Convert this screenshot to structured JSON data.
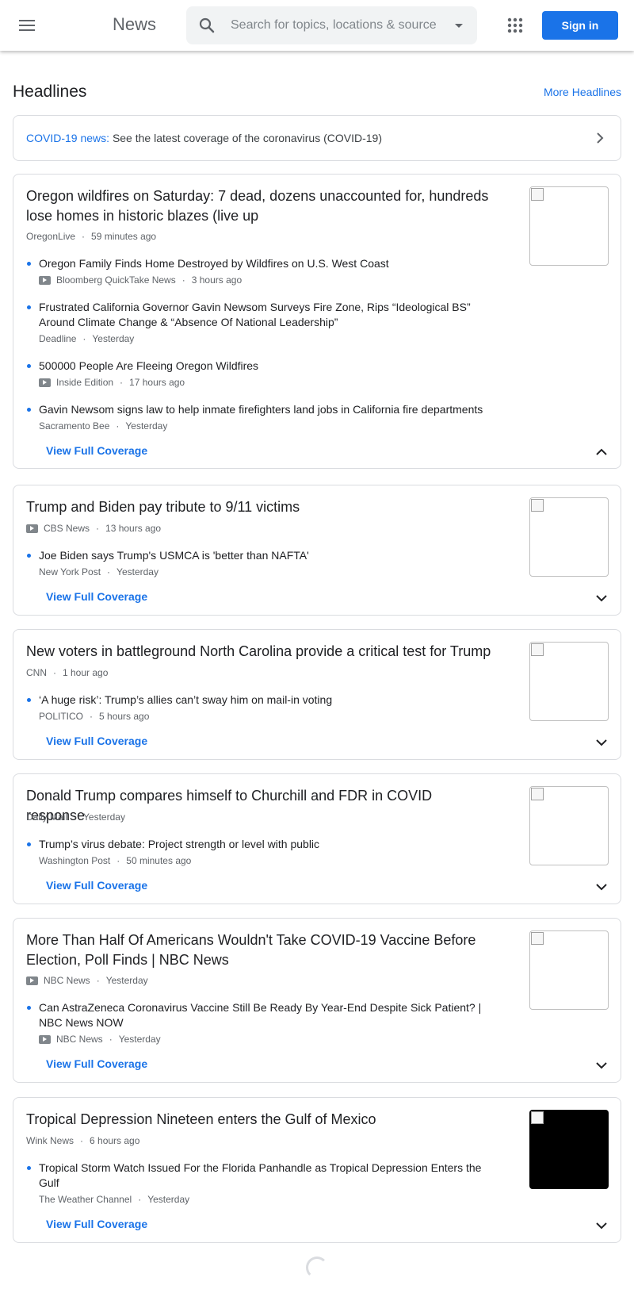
{
  "header": {
    "logo": "News",
    "search_placeholder": "Search for topics, locations & sources",
    "sign_in": "Sign in"
  },
  "section": {
    "title": "Headlines",
    "more_link": "More Headlines"
  },
  "covid_banner": {
    "label": "COVID-19 news:",
    "text": "See the latest coverage of the coronavirus (COVID-19)"
  },
  "view_full_coverage": "View Full Coverage",
  "stories": [
    {
      "title": "Oregon wildfires on Saturday: 7 dead, dozens unaccounted for, hundreds lose homes in historic blazes (live up",
      "source": "OregonLive",
      "time": "59 minutes ago",
      "expanded": true,
      "related": [
        {
          "title": "Oregon Family Finds Home Destroyed by Wildfires on U.S. West Coast",
          "source": "Bloomberg QuickTake News",
          "time": "3 hours ago",
          "video": true
        },
        {
          "title": "Frustrated California Governor Gavin Newsom Surveys Fire Zone, Rips “Ideological BS” Around Climate Change & “Absence Of National Leadership”",
          "source": "Deadline",
          "time": "Yesterday",
          "video": false
        },
        {
          "title": "500000 People Are Fleeing Oregon Wildfires",
          "source": "Inside Edition",
          "time": "17 hours ago",
          "video": true
        },
        {
          "title": "Gavin Newsom signs law to help inmate firefighters land jobs in California fire departments",
          "source": "Sacramento Bee",
          "time": "Yesterday",
          "video": false
        }
      ]
    },
    {
      "title": "Trump and Biden pay tribute to 9/11 victims",
      "source": "CBS News",
      "time": "13 hours ago",
      "video": true,
      "related": [
        {
          "title": "Joe Biden says Trump's USMCA is 'better than NAFTA'",
          "source": "New York Post",
          "time": "Yesterday",
          "video": false
        }
      ]
    },
    {
      "title": "New voters in battleground North Carolina provide a critical test for Trump",
      "source": "CNN",
      "time": "1 hour ago",
      "related": [
        {
          "title": "‘A huge risk’: Trump’s allies can’t sway him on mail-in voting",
          "source": "POLITICO",
          "time": "5 hours ago",
          "video": false
        }
      ]
    },
    {
      "title": "Donald Trump compares himself to Churchill and FDR in COVID response",
      "source": "Daily Mail",
      "time": "Yesterday",
      "related": [
        {
          "title": "Trump’s virus debate: Project strength or level with public",
          "source": "Washington Post",
          "time": "50 minutes ago",
          "video": false
        }
      ]
    },
    {
      "title": "More Than Half Of Americans Wouldn't Take COVID-19 Vaccine Before Election, Poll Finds | NBC News",
      "source": "NBC News",
      "time": "Yesterday",
      "video": true,
      "related": [
        {
          "title": "Can AstraZeneca Coronavirus Vaccine Still Be Ready By Year-End Despite Sick Patient? | NBC News NOW",
          "source": "NBC News",
          "time": "Yesterday",
          "video": true
        }
      ]
    },
    {
      "title": "Tropical Depression Nineteen enters the Gulf of Mexico",
      "source": "Wink News",
      "time": "6 hours ago",
      "related": [
        {
          "title": "Tropical Storm Watch Issued For the Florida Panhandle as Tropical Depression Enters the Gulf",
          "source": "The Weather Channel",
          "time": "Yesterday",
          "video": false
        }
      ]
    }
  ]
}
